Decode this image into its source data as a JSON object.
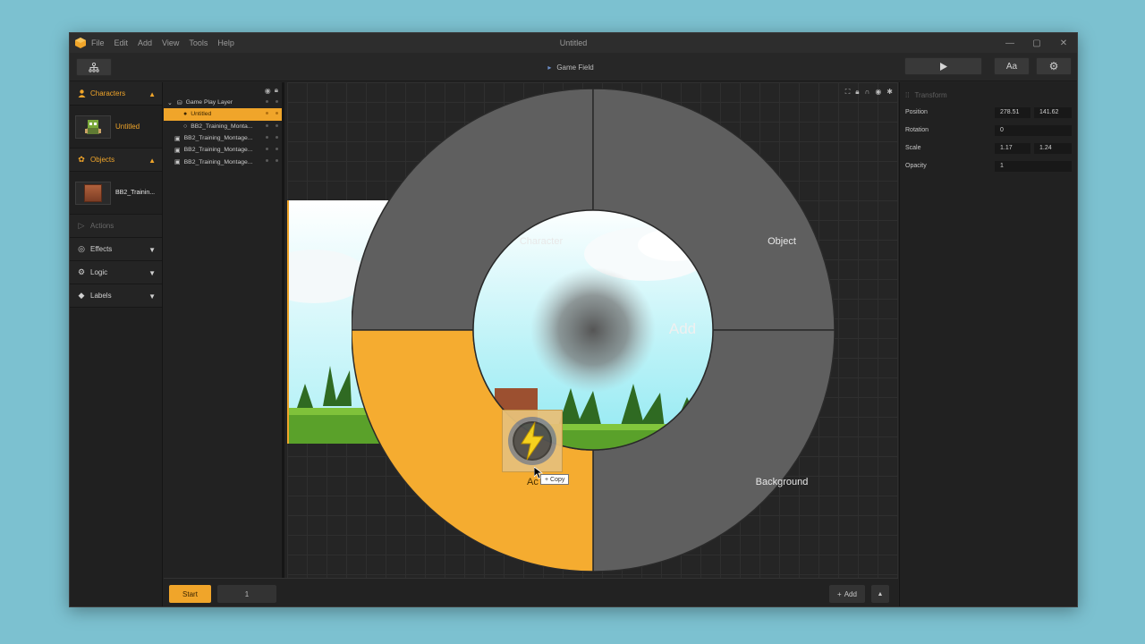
{
  "window": {
    "title": "Untitled"
  },
  "menu": [
    "File",
    "Edit",
    "Add",
    "View",
    "Tools",
    "Help"
  ],
  "toolbar": {
    "center_label": "Game Field",
    "font_button": "Aa"
  },
  "left_panel": {
    "characters_label": "Characters",
    "character_item": "Untitled",
    "objects_label": "Objects",
    "object_item": "BB2_Trainin...",
    "actions_label": "Actions",
    "effects_label": "Effects",
    "logic_label": "Logic",
    "labels_label": "Labels"
  },
  "layers": [
    {
      "label": "Game Play Layer",
      "icon": "layer-icon",
      "indent": 0,
      "selected": false
    },
    {
      "label": "Untitled",
      "icon": "person-icon",
      "indent": 1,
      "selected": true
    },
    {
      "label": "BB2_Training_Monta...",
      "icon": "circle-icon",
      "indent": 1,
      "selected": false
    },
    {
      "label": "BB2_Training_Montage...",
      "icon": "image-icon",
      "indent": 0,
      "selected": false
    },
    {
      "label": "BB2_Training_Montage...",
      "icon": "image-icon",
      "indent": 0,
      "selected": false
    },
    {
      "label": "BB2_Training_Montage...",
      "icon": "image-icon",
      "indent": 0,
      "selected": false
    }
  ],
  "radial_menu": {
    "center_label": "Add",
    "character": "Character",
    "object": "Object",
    "background": "Background",
    "action_partial": "Ac",
    "copy_label": "Copy"
  },
  "bottom_bar": {
    "start_button": "Start",
    "frame_value": "1",
    "add_button": "Add"
  },
  "transform": {
    "header": "Transform",
    "position_label": "Position",
    "position_x": "278.51",
    "position_y": "141.62",
    "rotation_label": "Rotation",
    "rotation": "0",
    "scale_label": "Scale",
    "scale_x": "1.17",
    "scale_y": "1.24",
    "opacity_label": "Opacity",
    "opacity": "1"
  },
  "colors": {
    "accent": "#f0a52a",
    "segment": "#5f5f5f",
    "background": "#7cc1d0"
  }
}
